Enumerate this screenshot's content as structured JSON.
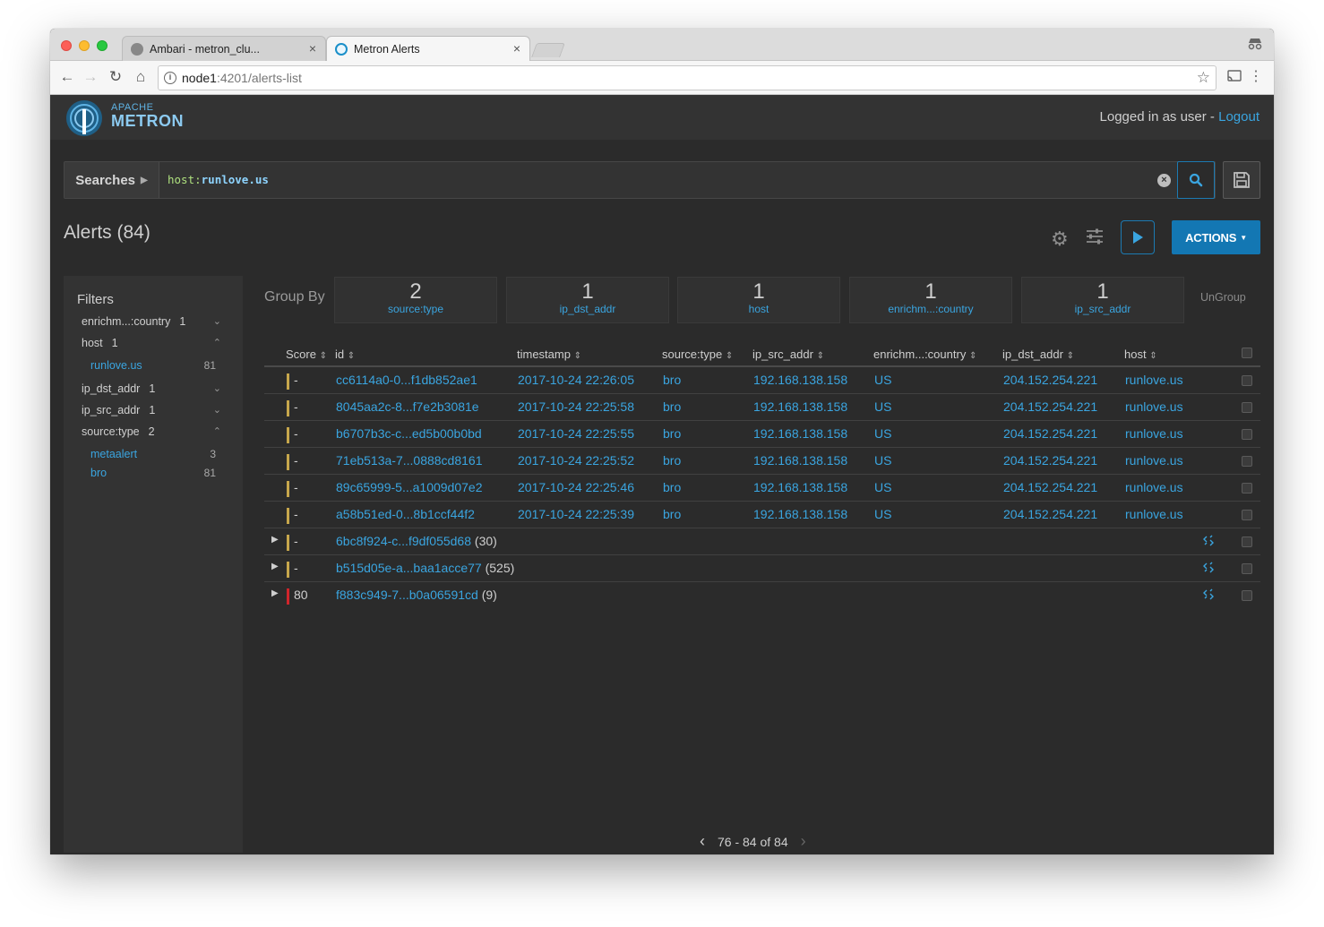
{
  "browser": {
    "tabs": [
      {
        "title": "Ambari - metron_clu...",
        "close": "×"
      },
      {
        "title": "Metron Alerts",
        "close": "×"
      }
    ],
    "url_host": "node1",
    "url_rest": ":4201/alerts-list"
  },
  "header": {
    "logo_top": "APACHE",
    "logo_main": "METRON",
    "login_text": "Logged in as user - ",
    "logout_label": "Logout"
  },
  "search": {
    "searches_label": "Searches",
    "query_field": "host:",
    "query_value": "runlove.us"
  },
  "alerts": {
    "title": "Alerts (84)",
    "actions_label": "ACTIONS"
  },
  "filters": {
    "title": "Filters",
    "facets": [
      {
        "name": "enrichm...:country",
        "count": "1",
        "expanded": false
      },
      {
        "name": "host",
        "count": "1",
        "expanded": true,
        "values": [
          {
            "label": "runlove.us",
            "count": "81"
          }
        ]
      },
      {
        "name": "ip_dst_addr",
        "count": "1",
        "expanded": false
      },
      {
        "name": "ip_src_addr",
        "count": "1",
        "expanded": false
      },
      {
        "name": "source:type",
        "count": "2",
        "expanded": true,
        "values": [
          {
            "label": "metaalert",
            "count": "3"
          },
          {
            "label": "bro",
            "count": "81"
          }
        ]
      }
    ]
  },
  "group_by": {
    "label": "Group By",
    "ungroup_label": "UnGroup",
    "cards": [
      {
        "count": "2",
        "name": "source:type"
      },
      {
        "count": "1",
        "name": "ip_dst_addr"
      },
      {
        "count": "1",
        "name": "host"
      },
      {
        "count": "1",
        "name": "enrichm...:country"
      },
      {
        "count": "1",
        "name": "ip_src_addr"
      }
    ]
  },
  "table": {
    "columns": [
      "Score",
      "id",
      "timestamp",
      "source:type",
      "ip_src_addr",
      "enrichm...:country",
      "ip_dst_addr",
      "host"
    ],
    "rows": [
      {
        "score": "-",
        "id": "cc6114a0-0...f1db852ae1",
        "timestamp": "2017-10-24 22:26:05",
        "source_type": "bro",
        "ip_src": "192.168.138.158",
        "country": "US",
        "ip_dst": "204.152.254.221",
        "host": "runlove.us"
      },
      {
        "score": "-",
        "id": "8045aa2c-8...f7e2b3081e",
        "timestamp": "2017-10-24 22:25:58",
        "source_type": "bro",
        "ip_src": "192.168.138.158",
        "country": "US",
        "ip_dst": "204.152.254.221",
        "host": "runlove.us"
      },
      {
        "score": "-",
        "id": "b6707b3c-c...ed5b00b0bd",
        "timestamp": "2017-10-24 22:25:55",
        "source_type": "bro",
        "ip_src": "192.168.138.158",
        "country": "US",
        "ip_dst": "204.152.254.221",
        "host": "runlove.us"
      },
      {
        "score": "-",
        "id": "71eb513a-7...0888cd8161",
        "timestamp": "2017-10-24 22:25:52",
        "source_type": "bro",
        "ip_src": "192.168.138.158",
        "country": "US",
        "ip_dst": "204.152.254.221",
        "host": "runlove.us"
      },
      {
        "score": "-",
        "id": "89c65999-5...a1009d07e2",
        "timestamp": "2017-10-24 22:25:46",
        "source_type": "bro",
        "ip_src": "192.168.138.158",
        "country": "US",
        "ip_dst": "204.152.254.221",
        "host": "runlove.us"
      },
      {
        "score": "-",
        "id": "a58b51ed-0...8b1ccf44f2",
        "timestamp": "2017-10-24 22:25:39",
        "source_type": "bro",
        "ip_src": "192.168.138.158",
        "country": "US",
        "ip_dst": "204.152.254.221",
        "host": "runlove.us"
      }
    ],
    "meta_rows": [
      {
        "score": "-",
        "id": "6bc8f924-c...f9df055d68",
        "count": "(30)"
      },
      {
        "score": "-",
        "id": "b515d05e-a...baa1acce77",
        "count": "(525)"
      },
      {
        "score": "80",
        "id": "f883c949-7...b0a06591cd",
        "count": "(9)"
      }
    ]
  },
  "pagination": {
    "range": "76 - 84 of 84"
  },
  "colors": {
    "accent": "#3aa5e0",
    "score_low": "#c7a74c",
    "score_high": "#d0242b",
    "actions_bg": "#1377b3"
  }
}
